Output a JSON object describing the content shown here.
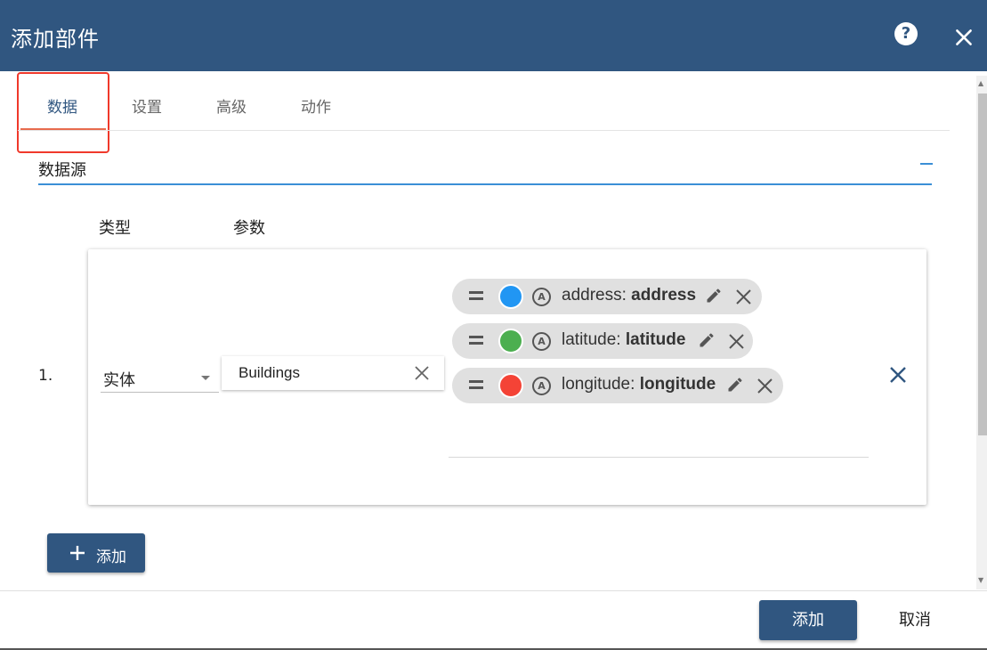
{
  "dialog": {
    "title": "添加部件",
    "help_icon": "help-circle-icon",
    "close_icon": "close-icon"
  },
  "tabs": [
    {
      "label": "数据",
      "active": true
    },
    {
      "label": "设置",
      "active": false
    },
    {
      "label": "高级",
      "active": false
    },
    {
      "label": "动作",
      "active": false
    }
  ],
  "datasources": {
    "title": "数据源",
    "collapse_icon": "minus-icon",
    "columns": {
      "type": "类型",
      "params": "参数"
    },
    "rows": [
      {
        "index": "1.",
        "type": "实体",
        "entity_alias": "Buildings",
        "keys": [
          {
            "label": "address",
            "value": "address",
            "color": "#2196f3"
          },
          {
            "label": "latitude",
            "value": "latitude",
            "color": "#4caf50"
          },
          {
            "label": "longitude",
            "value": "longitude",
            "color": "#f44336"
          }
        ]
      }
    ],
    "add_label": "添加"
  },
  "footer": {
    "add_label": "添加",
    "cancel_label": "取消"
  },
  "colors": {
    "primary": "#305680",
    "accent_underline": "#3b8fd6",
    "tab_indicator": "#e86c4e",
    "highlight_box": "#f0392b"
  }
}
